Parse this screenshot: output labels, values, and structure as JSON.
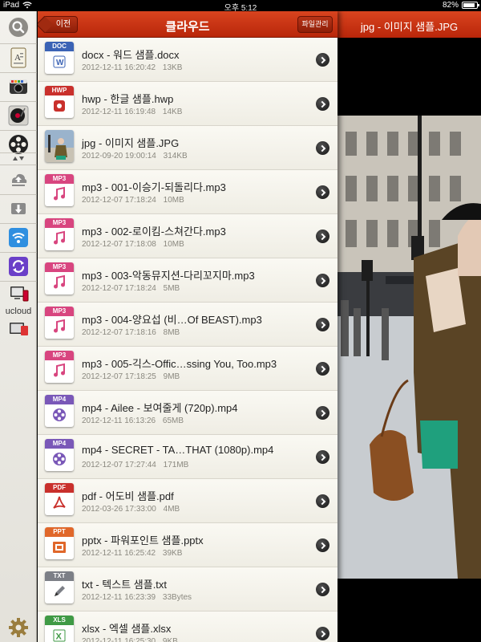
{
  "status": {
    "device": "iPad",
    "time": "오후 5:12",
    "battery": "82%",
    "battery_level": 0.82
  },
  "sidebar": {
    "ucloud_label": "ucloud"
  },
  "navbar": {
    "title": "클라우드",
    "back_label": "이전",
    "file_manager_label": "파일관리"
  },
  "preview": {
    "title": "jpg - 이미지 샘플.JPG"
  },
  "files": [
    {
      "type": "DOC",
      "name": "docx - 워드 샘플.docx",
      "date": "2012-12-11 16:20:42",
      "size": "13KB",
      "color": "#3b63b5"
    },
    {
      "type": "HWP",
      "name": "hwp - 한글 샘플.hwp",
      "date": "2012-12-11 16:19:48",
      "size": "14KB",
      "color": "#c9302c"
    },
    {
      "type": "JPG",
      "name": "jpg - 이미지 샘플.JPG",
      "date": "2012-09-20 19:00:14",
      "size": "314KB",
      "color": "#6a8fb0"
    },
    {
      "type": "MP3",
      "name": "mp3 - 001-이승기-되돌리다.mp3",
      "date": "2012-12-07 17:18:24",
      "size": "10MB",
      "color": "#d8457f"
    },
    {
      "type": "MP3",
      "name": "mp3 - 002-로이킴-스쳐간다.mp3",
      "date": "2012-12-07 17:18:08",
      "size": "10MB",
      "color": "#d8457f"
    },
    {
      "type": "MP3",
      "name": "mp3 - 003-악동뮤지션-다리꼬지마.mp3",
      "date": "2012-12-07 17:18:24",
      "size": "5MB",
      "color": "#d8457f"
    },
    {
      "type": "MP3",
      "name": "mp3 - 004-양요섭 (비…Of BEAST).mp3",
      "date": "2012-12-07 17:18:16",
      "size": "8MB",
      "color": "#d8457f"
    },
    {
      "type": "MP3",
      "name": "mp3 - 005-긱스-Offic…ssing You, Too.mp3",
      "date": "2012-12-07 17:18:25",
      "size": "9MB",
      "color": "#d8457f"
    },
    {
      "type": "MP4",
      "name": "mp4 - Ailee - 보여줄게 (720p).mp4",
      "date": "2012-12-11 16:13:26",
      "size": "65MB",
      "color": "#7a58b8"
    },
    {
      "type": "MP4",
      "name": "mp4 - SECRET - TA…THAT (1080p).mp4",
      "date": "2012-12-07 17:27:44",
      "size": "171MB",
      "color": "#7a58b8"
    },
    {
      "type": "PDF",
      "name": "pdf - 어도비 샘플.pdf",
      "date": "2012-03-26 17:33:00",
      "size": "4MB",
      "color": "#c9302c"
    },
    {
      "type": "PPT",
      "name": "pptx - 파워포인트 샘플.pptx",
      "date": "2012-12-11 16:25:42",
      "size": "39KB",
      "color": "#e0672a"
    },
    {
      "type": "TXT",
      "name": "txt - 텍스트 샘플.txt",
      "date": "2012-12-11 16:23:39",
      "size": "33Bytes",
      "color": "#7c7f86"
    },
    {
      "type": "XLS",
      "name": "xlsx - 엑셀 샘플.xlsx",
      "date": "2012-12-11 16:25:30",
      "size": "9KB",
      "color": "#3f9a45"
    }
  ]
}
